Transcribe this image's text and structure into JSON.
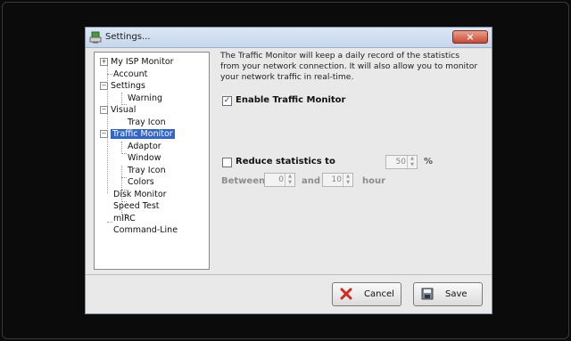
{
  "window": {
    "title": "Settings...",
    "close_glyph": "×"
  },
  "tree": {
    "items": [
      {
        "label": "My ISP Monitor",
        "expander": "+"
      },
      {
        "label": "Account"
      },
      {
        "label": "Settings",
        "expander": "−"
      },
      {
        "label": "Warning"
      },
      {
        "label": "Visual",
        "expander": "−"
      },
      {
        "label": "Tray Icon"
      },
      {
        "label": "Traffic Monitor",
        "expander": "−",
        "selected": true
      },
      {
        "label": "Adaptor"
      },
      {
        "label": "Window"
      },
      {
        "label": "Tray Icon"
      },
      {
        "label": "Colors"
      },
      {
        "label": "Disk Monitor"
      },
      {
        "label": "Speed Test"
      },
      {
        "label": "mIRC"
      },
      {
        "label": "Command-Line"
      }
    ]
  },
  "content": {
    "description": "The Traffic Monitor will keep a daily record of the statistics from your network connection. It will also allow you to monitor your network traffic in real-time.",
    "enable_label": "Enable Traffic Monitor",
    "enable_checked": true,
    "check_glyph": "✓",
    "reduce_label": "Reduce statistics to",
    "reduce_checked": false,
    "percent_value": "50",
    "percent_unit": "%",
    "between_label": "Between",
    "between_from": "0",
    "and_label": "and",
    "between_to": "10",
    "hour_label": "hour",
    "spin_up": "▲",
    "spin_down": "▼"
  },
  "buttons": {
    "cancel_label": "Cancel",
    "save_label": "Save"
  },
  "colors": {
    "selection": "#3366cc",
    "check": "#1c3e9e",
    "cancel_icon": "#d12a1c",
    "close_button": "#c74a33"
  }
}
